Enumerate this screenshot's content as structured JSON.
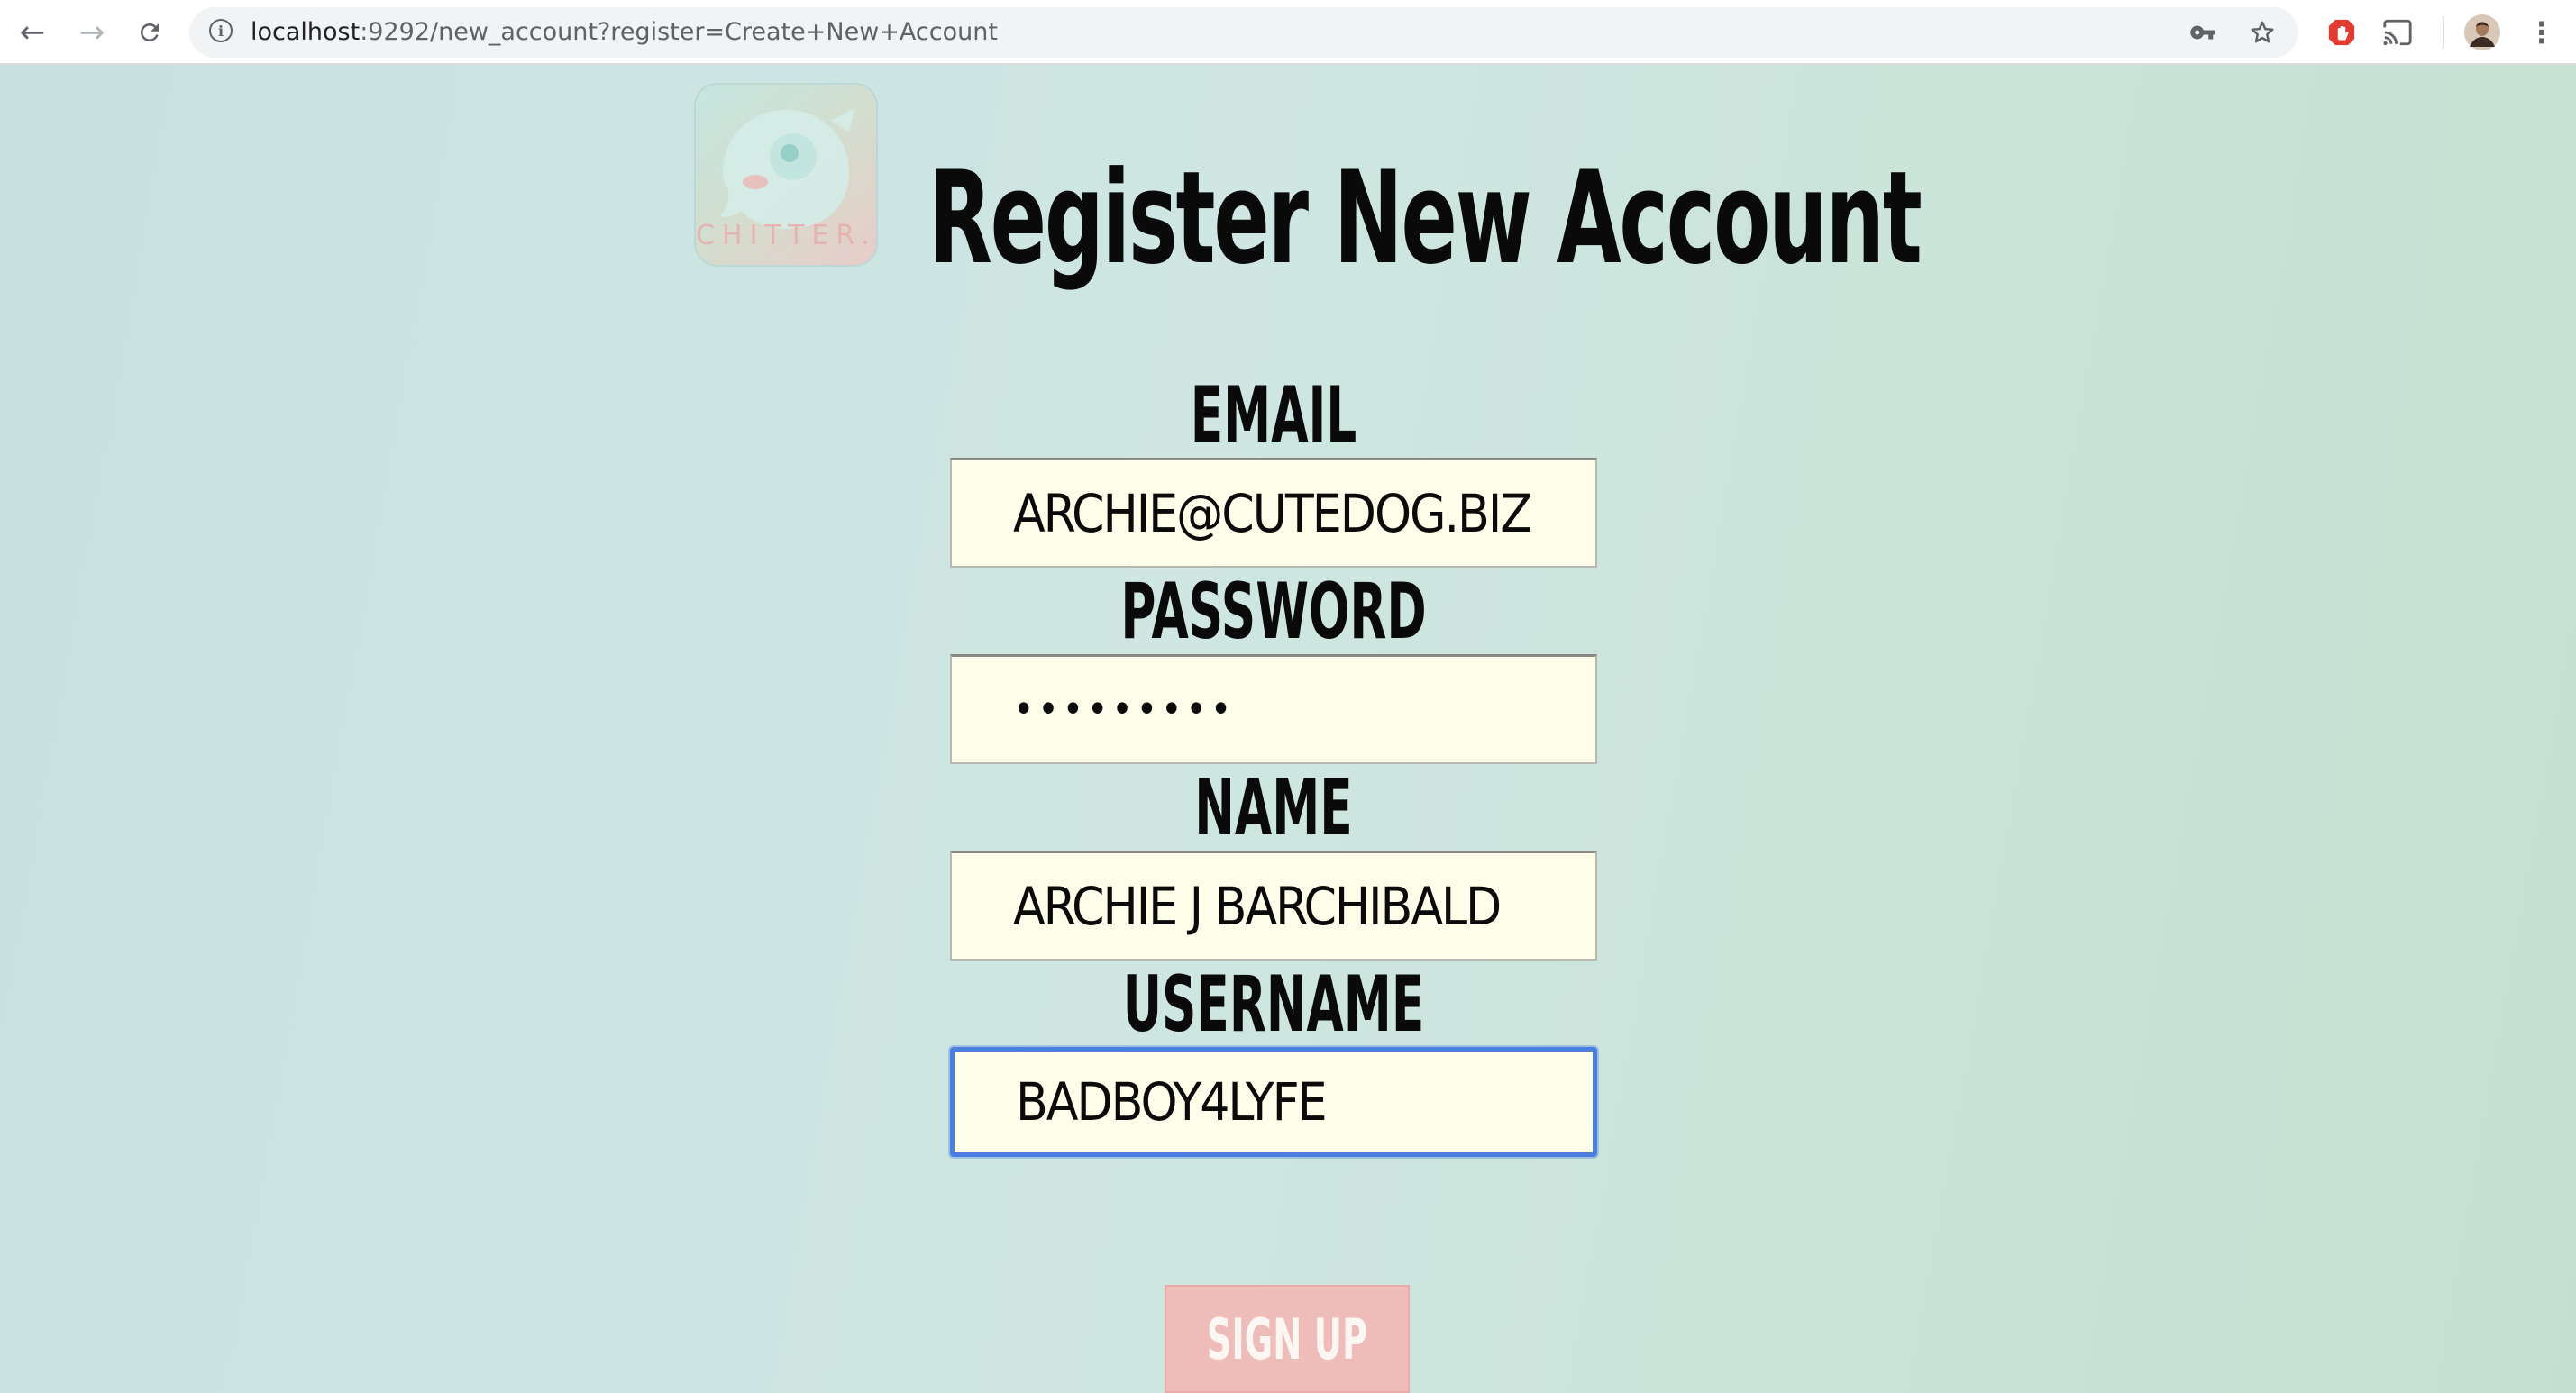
{
  "browser": {
    "url_host": "localhost",
    "url_rest": ":9292/new_account?register=Create+New+Account",
    "icons": {
      "back": "arrow-left-icon",
      "forward": "arrow-right-icon",
      "reload": "reload-icon",
      "info": "info-icon",
      "key": "key-icon",
      "star": "star-icon",
      "adblock": "adblock-icon",
      "cast": "cast-icon",
      "avatar": "avatar-icon",
      "menu": "more-vertical-icon"
    }
  },
  "page": {
    "logo_text": "CHITTER.",
    "title": "Register New Account",
    "colors": {
      "input_bg": "#fefde9",
      "button_bg": "#efbdb9",
      "focus_ring": "#4a7fe0"
    }
  },
  "form": {
    "email": {
      "label": "Email",
      "value": "archie@cutedog.biz"
    },
    "password": {
      "label": "Password",
      "value": "•••••••••"
    },
    "name": {
      "label": "Name",
      "value": "Archie J Barchibald"
    },
    "username": {
      "label": "Username",
      "value": "badboy4lyfe"
    },
    "submit_label": "Sign up"
  }
}
